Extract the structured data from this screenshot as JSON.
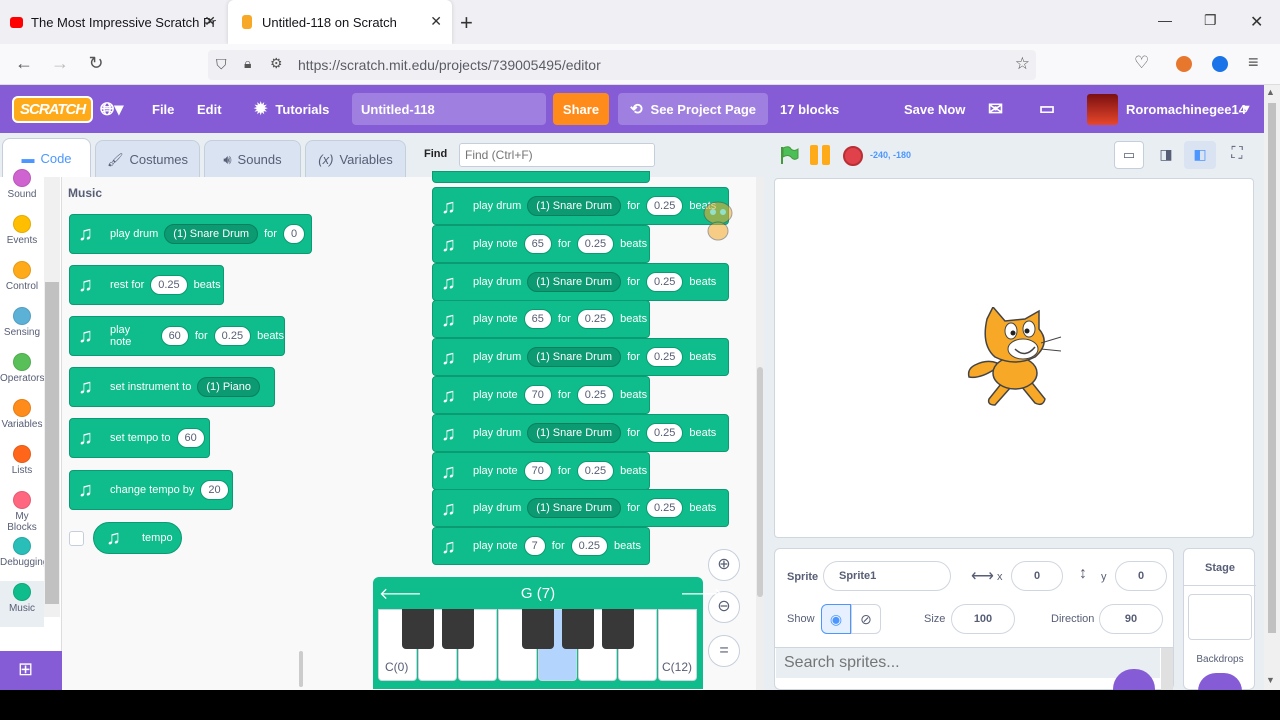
{
  "browser": {
    "tabs": [
      {
        "title": "The Most Impressive Scratch Pr",
        "close": "✕"
      },
      {
        "title": "Untitled-118 on Scratch",
        "close": "✕"
      }
    ],
    "new_tab": "+",
    "url": "https://scratch.mit.edu/projects/739005495/editor",
    "window_controls": {
      "minimize": "—",
      "restore": "❐",
      "close": "✕"
    }
  },
  "menubar": {
    "logo": "SCRATCH",
    "file": "File",
    "edit": "Edit",
    "tutorials": "Tutorials",
    "project_title": "Untitled-118",
    "share": "Share",
    "see_project_page": "See Project Page",
    "block_count": "17 blocks",
    "save_now": "Save Now",
    "username": "Roromachinegee14"
  },
  "editor_tabs": {
    "code": "Code",
    "costumes": "Costumes",
    "sounds": "Sounds",
    "variables": "Variables"
  },
  "find": {
    "label": "Find",
    "placeholder": "Find (Ctrl+F)"
  },
  "stage_controls": {
    "coords": "-240, -180"
  },
  "categories": [
    {
      "label": "Sound",
      "color": "#cf63cf"
    },
    {
      "label": "Events",
      "color": "#ffbf00"
    },
    {
      "label": "Control",
      "color": "#ffab19"
    },
    {
      "label": "Sensing",
      "color": "#5cb1d6"
    },
    {
      "label": "Operators",
      "color": "#59c059"
    },
    {
      "label": "Variables",
      "color": "#ff8c1a"
    },
    {
      "label": "Lists",
      "color": "#ff661a"
    },
    {
      "label": "My Blocks",
      "color": "#ff6680"
    },
    {
      "label": "Debugging",
      "color": "#29beb8"
    },
    {
      "label": "Music",
      "color": "#0fbd8c"
    }
  ],
  "palette": {
    "heading": "Music",
    "play_drum": {
      "text": "play drum",
      "drum": "(1) Snare Drum",
      "for": "for",
      "val": "0"
    },
    "rest": {
      "text": "rest for",
      "val": "0.25",
      "beats": "beats"
    },
    "play_note": {
      "text": "play note",
      "note": "60",
      "for": "for",
      "val": "0.25",
      "beats": "beats"
    },
    "set_instrument": {
      "text": "set instrument to",
      "val": "(1) Piano"
    },
    "set_tempo": {
      "text": "set tempo to",
      "val": "60"
    },
    "change_tempo": {
      "text": "change tempo by",
      "val": "20"
    },
    "tempo": {
      "text": "tempo"
    }
  },
  "script_blocks": [
    {
      "type": "drum",
      "text": "play drum",
      "drum": "(1) Snare Drum",
      "for": "for",
      "val": "0.25",
      "beats": "beats"
    },
    {
      "type": "note",
      "text": "play note",
      "note": "65",
      "for": "for",
      "val": "0.25",
      "beats": "beats"
    },
    {
      "type": "drum",
      "text": "play drum",
      "drum": "(1) Snare Drum",
      "for": "for",
      "val": "0.25",
      "beats": "beats"
    },
    {
      "type": "note",
      "text": "play note",
      "note": "65",
      "for": "for",
      "val": "0.25",
      "beats": "beats"
    },
    {
      "type": "drum",
      "text": "play drum",
      "drum": "(1) Snare Drum",
      "for": "for",
      "val": "0.25",
      "beats": "beats"
    },
    {
      "type": "note",
      "text": "play note",
      "note": "70",
      "for": "for",
      "val": "0.25",
      "beats": "beats"
    },
    {
      "type": "drum",
      "text": "play drum",
      "drum": "(1) Snare Drum",
      "for": "for",
      "val": "0.25",
      "beats": "beats"
    },
    {
      "type": "note",
      "text": "play note",
      "note": "70",
      "for": "for",
      "val": "0.25",
      "beats": "beats"
    },
    {
      "type": "drum",
      "text": "play drum",
      "drum": "(1) Snare Drum",
      "for": "for",
      "val": "0.25",
      "beats": "beats"
    },
    {
      "type": "note",
      "text": "play note",
      "note": "7",
      "for": "for",
      "val": "0.25",
      "beats": "beats"
    }
  ],
  "piano": {
    "note_name": "G (7)",
    "low_label": "C(0)",
    "high_label": "C(12)"
  },
  "sprite_info": {
    "sprite_label": "Sprite",
    "sprite_name": "Sprite1",
    "x_label": "x",
    "x": "0",
    "y_label": "y",
    "y": "0",
    "show_label": "Show",
    "size_label": "Size",
    "size": "100",
    "direction_label": "Direction",
    "direction": "90",
    "search_placeholder": "Search sprites..."
  },
  "stage_pane": {
    "title": "Stage",
    "backdrops": "Backdrops"
  }
}
